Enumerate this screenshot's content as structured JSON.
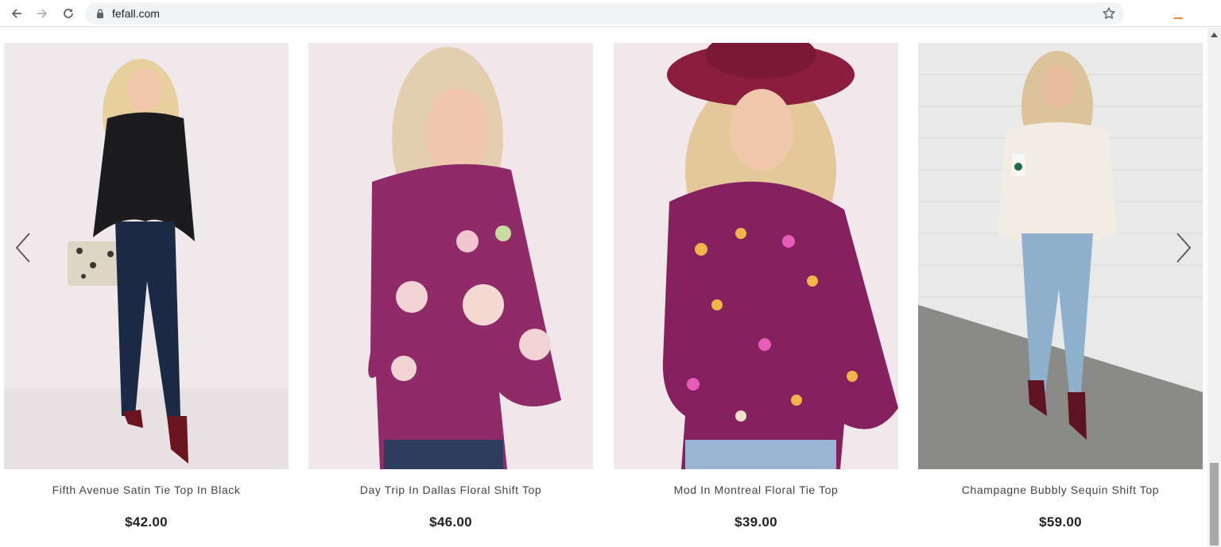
{
  "browser": {
    "url": "fefall.com",
    "icons": [
      "back-arrow-icon",
      "forward-arrow-icon",
      "reload-icon",
      "lock-icon",
      "star-icon"
    ]
  },
  "carousel": {
    "prev_icon": "chevron-left-icon",
    "next_icon": "chevron-right-icon",
    "products": [
      {
        "name": "Fifth Avenue Satin Tie Top In Black",
        "price": "$42.00",
        "top_color": "#1c1b1d",
        "background": "#efe9ec"
      },
      {
        "name": "Day Trip In Dallas Floral Shift Top",
        "price": "$46.00",
        "top_color": "#8e2b68",
        "background": "#f1e6ea"
      },
      {
        "name": "Mod In Montreal Floral Tie Top",
        "price": "$39.00",
        "top_color": "#86215f",
        "background": "#f2e7eb"
      },
      {
        "name": "Champagne Bubbly Sequin Shift Top",
        "price": "$59.00",
        "top_color": "#f3ece2",
        "background": "#e9e9ea"
      }
    ]
  }
}
